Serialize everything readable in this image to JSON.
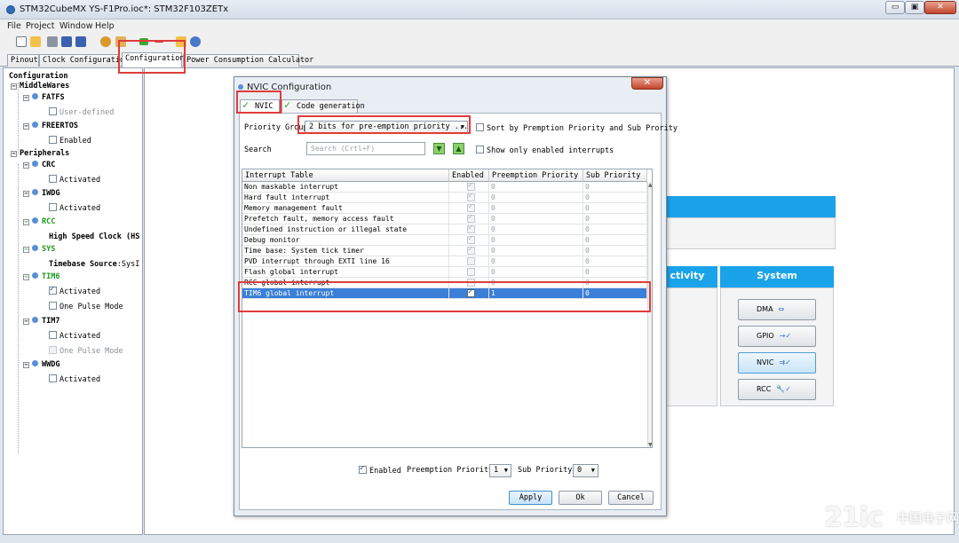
{
  "window": {
    "title": "STM32CubeMX YS-F1Pro.ioc*: STM32F103ZETx",
    "min": "▭",
    "restore": "▣",
    "close": "✕"
  },
  "menu": [
    "File",
    "Project",
    "Window",
    "Help"
  ],
  "tabs": [
    "Pinout",
    "Clock Configuration",
    "Configuration",
    "Power Consumption Calculator"
  ],
  "tree": {
    "root": "Configuration",
    "middlewares": "MiddleWares",
    "fatfs": "FATFS",
    "fatfs_user_defined": "User-defined",
    "freertos": "FREERTOS",
    "freertos_enabled": "Enabled",
    "peripherals": "Peripherals",
    "crc": "CRC",
    "crc_activated": "Activated",
    "iwdg": "IWDG",
    "iwdg_activated": "Activated",
    "rcc": "RCC",
    "rcc_hsc": "High Speed Clock (HS",
    "sys": "SYS",
    "sys_timebase_label": "Timebase Source",
    "sys_timebase_value": "SysI",
    "tim6": "TIM6",
    "tim6_activated": "Activated",
    "tim6_one_pulse": "One Pulse Mode",
    "tim7": "TIM7",
    "tim7_activated": "Activated",
    "tim7_one_pulse": "One Pulse Mode",
    "wwdg": "WWDG",
    "wwdg_activated": "Activated"
  },
  "main": {
    "connectivity_head": "ctivity",
    "system_head": "System",
    "system_buttons": [
      "DMA",
      "GPIO",
      "NVIC",
      "RCC"
    ]
  },
  "dialog": {
    "title": "NVIC Configuration",
    "close": "✕",
    "tabs": [
      "NVIC",
      "Code generation"
    ],
    "priority_group_label": "Priority Group",
    "priority_group_value": "2 bits for pre-emption priority ...",
    "sort_label": "Sort by Premption Priority and Sub Prority",
    "search_label": "Search",
    "search_placeholder": "Search (Crtl+F)",
    "show_enabled_label": "Show only enabled interrupts",
    "columns": [
      "Interrupt Table",
      "Enabled",
      "Preemption Priority",
      "Sub Priority"
    ],
    "rows": [
      {
        "name": "Non maskable interrupt",
        "preempt": "0",
        "sub": "0"
      },
      {
        "name": "Hard fault interrupt",
        "preempt": "0",
        "sub": "0"
      },
      {
        "name": "Memory management fault",
        "preempt": "0",
        "sub": "0"
      },
      {
        "name": "Prefetch fault, memory access fault",
        "preempt": "0",
        "sub": "0"
      },
      {
        "name": "Undefined instruction or illegal state",
        "preempt": "0",
        "sub": "0"
      },
      {
        "name": "Debug monitor",
        "preempt": "0",
        "sub": "0"
      },
      {
        "name": "Time base: System tick timer",
        "preempt": "0",
        "sub": "0"
      },
      {
        "name": "PVD interrupt through EXTI line 16",
        "preempt": "0",
        "sub": "0"
      },
      {
        "name": "Flash global interrupt",
        "preempt": "0",
        "sub": "0"
      },
      {
        "name": "RCC global interrupt",
        "preempt": "0",
        "sub": "0"
      },
      {
        "name": "TIM6 global interrupt",
        "preempt": "1",
        "sub": "0"
      }
    ],
    "footer_enabled": "Enabled",
    "footer_preempt_label": "Preemption Priority",
    "footer_preempt_value": "1",
    "footer_sub_label": "Sub Priority",
    "footer_sub_value": "0",
    "apply": "Apply",
    "ok": "Ok",
    "cancel": "Cancel"
  },
  "watermark": {
    "main": "21ic",
    "sub": "中国电子网"
  },
  "colors": {
    "accent": "#1aa3e8",
    "highlight": "#e03b3b",
    "selection": "#3c7fd6",
    "status_green": "#1d9a1d"
  }
}
